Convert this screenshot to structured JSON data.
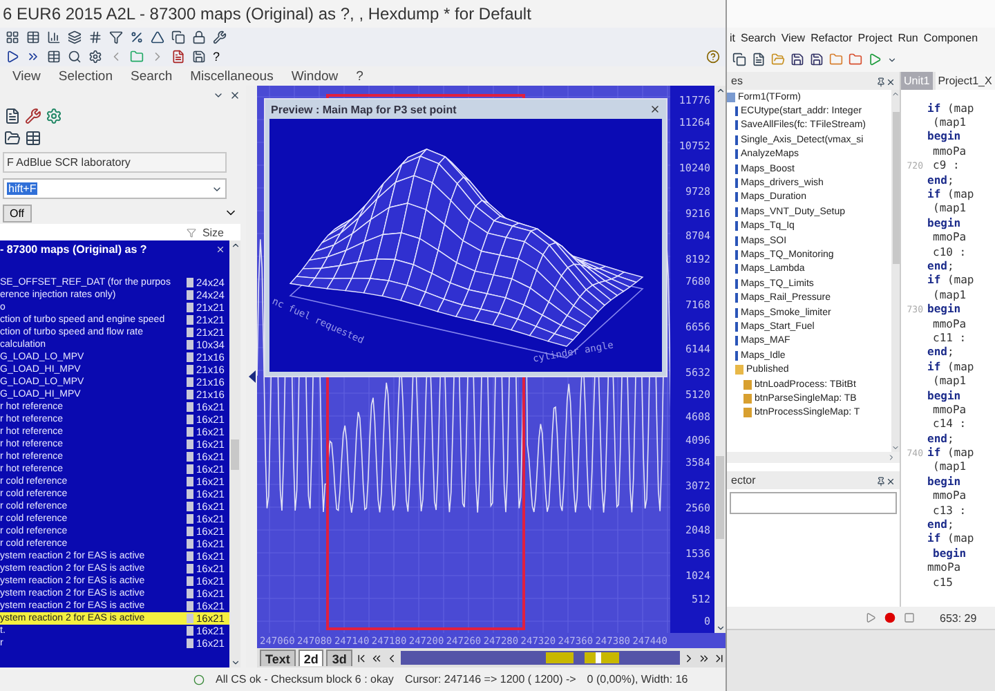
{
  "left_app": {
    "title": "6 EUR6 2015 A2L - 87300 maps (Original) as ?, , Hexdump * for Default",
    "toolbar_help": "?",
    "menu": [
      "View",
      "Selection",
      "Search",
      "Miscellaneous",
      "Window",
      "?"
    ],
    "panel": {
      "project_field": "F AdBlue SCR laboratory",
      "search_value": "hift+F",
      "filter_button": "Off",
      "size_header": "Size",
      "list_title": "- 87300 maps (Original) as ?",
      "maps": [
        {
          "name": "SE_OFFSET_REF_DAT (for the purpos",
          "size": "24x24",
          "selected": false
        },
        {
          "name": "erence injection rates only)",
          "size": "24x24",
          "selected": false
        },
        {
          "name": "o",
          "size": "21x21",
          "selected": false
        },
        {
          "name": "ction of turbo speed and engine speed",
          "size": "21x21",
          "selected": false
        },
        {
          "name": "ction of turbo speed and flow rate",
          "size": "21x21",
          "selected": false
        },
        {
          "name": "calculation",
          "size": "10x34",
          "selected": false
        },
        {
          "name": "G_LOAD_LO_MPV",
          "size": "21x16",
          "selected": false
        },
        {
          "name": "G_LOAD_HI_MPV",
          "size": "21x16",
          "selected": false
        },
        {
          "name": "G_LOAD_LO_MPV",
          "size": "21x16",
          "selected": false
        },
        {
          "name": "G_LOAD_HI_MPV",
          "size": "21x16",
          "selected": false
        },
        {
          "name": "r hot reference",
          "size": "16x21",
          "selected": false
        },
        {
          "name": "r hot reference",
          "size": "16x21",
          "selected": false
        },
        {
          "name": "r hot reference",
          "size": "16x21",
          "selected": false
        },
        {
          "name": "r hot reference",
          "size": "16x21",
          "selected": false
        },
        {
          "name": "r hot reference",
          "size": "16x21",
          "selected": false
        },
        {
          "name": "r hot reference",
          "size": "16x21",
          "selected": false
        },
        {
          "name": "r cold reference",
          "size": "16x21",
          "selected": false
        },
        {
          "name": "r cold reference",
          "size": "16x21",
          "selected": false
        },
        {
          "name": "r cold reference",
          "size": "16x21",
          "selected": false
        },
        {
          "name": "r cold reference",
          "size": "16x21",
          "selected": false
        },
        {
          "name": "r cold reference",
          "size": "16x21",
          "selected": false
        },
        {
          "name": "r cold reference",
          "size": "16x21",
          "selected": false
        },
        {
          "name": "ystem reaction 2 for EAS is active",
          "size": "16x21",
          "selected": false
        },
        {
          "name": "ystem reaction 2 for EAS is active",
          "size": "16x21",
          "selected": false
        },
        {
          "name": "ystem reaction 2 for EAS is active",
          "size": "16x21",
          "selected": false
        },
        {
          "name": "ystem reaction 2 for EAS is active",
          "size": "16x21",
          "selected": false
        },
        {
          "name": "ystem reaction 2 for EAS is active",
          "size": "16x21",
          "selected": false
        },
        {
          "name": "ystem reaction 2 for EAS is active",
          "size": "16x21",
          "selected": true
        },
        {
          "name": "t.",
          "size": "16x21",
          "selected": false
        },
        {
          "name": "r",
          "size": "16x21",
          "selected": false
        }
      ]
    },
    "graph": {
      "preview_title": "Preview : Main Map for P3 set point",
      "preview_axis_left": "nc fuel requested",
      "preview_axis_right": "cylinder angle",
      "y_labels": [
        "11776",
        "11264",
        "10752",
        "10240",
        "9728",
        "9216",
        "8704",
        "8192",
        "7680",
        "7168",
        "6656",
        "6144",
        "5632",
        "5120",
        "4608",
        "4096",
        "3584",
        "3072",
        "2560",
        "2048",
        "1536",
        "1024",
        "512",
        "0"
      ],
      "x_labels": [
        "247060",
        "247080",
        "247140",
        "247180",
        "247200",
        "247260",
        "247280",
        "247320",
        "247360",
        "247380",
        "247440"
      ],
      "view_tabs": [
        {
          "label": "Text",
          "selected": false
        },
        {
          "label": "2d",
          "selected": true
        },
        {
          "label": "3d",
          "selected": false
        }
      ]
    },
    "status": {
      "checksum": "All CS ok - Checksum block 6 : okay",
      "cursor": "Cursor: 247146 => 1200 ( 1200) ->",
      "width": "0 (0,00%), Width: 16"
    }
  },
  "right_app": {
    "menu": [
      "it",
      "Search",
      "View",
      "Refactor",
      "Project",
      "Run",
      "Componen"
    ],
    "structure": {
      "header": "es",
      "tree": [
        {
          "label": "Form1(TForm)",
          "kind": "class",
          "children": [
            {
              "label": "ECUtype(start_addr: Integer",
              "kind": "method"
            },
            {
              "label": "SaveAllFiles(fc: TFileStream)",
              "kind": "method"
            },
            {
              "label": "Single_Axis_Detect(vmax_si",
              "kind": "method"
            },
            {
              "label": "AnalyzeMaps",
              "kind": "method"
            },
            {
              "label": "Maps_Boost",
              "kind": "method"
            },
            {
              "label": "Maps_drivers_wish",
              "kind": "method"
            },
            {
              "label": "Maps_Duration",
              "kind": "method"
            },
            {
              "label": "Maps_VNT_Duty_Setup",
              "kind": "method"
            },
            {
              "label": "Maps_Tq_Iq",
              "kind": "method"
            },
            {
              "label": "Maps_SOI",
              "kind": "method"
            },
            {
              "label": "Maps_TQ_Monitoring",
              "kind": "method"
            },
            {
              "label": "Maps_Lambda",
              "kind": "method"
            },
            {
              "label": "Maps_TQ_Limits",
              "kind": "method"
            },
            {
              "label": "Maps_Rail_Pressure",
              "kind": "method"
            },
            {
              "label": "Maps_Smoke_limiter",
              "kind": "method"
            },
            {
              "label": "Maps_Start_Fuel",
              "kind": "method"
            },
            {
              "label": "Maps_MAF",
              "kind": "method"
            },
            {
              "label": "Maps_Idle",
              "kind": "method"
            },
            {
              "label": "Published",
              "kind": "folder",
              "children": [
                {
                  "label": "btnLoadProcess: TBitBt",
                  "kind": "field"
                },
                {
                  "label": "btnParseSingleMap: TB",
                  "kind": "field"
                },
                {
                  "label": "btnProcessSingleMap: T",
                  "kind": "field"
                }
              ]
            }
          ]
        }
      ]
    },
    "editor_tabs": [
      {
        "label": "Unit1",
        "selected": true
      },
      {
        "label": "Project1_X",
        "selected": false
      }
    ],
    "code": [
      {
        "text": "**if** (map"
      },
      {
        "text": "(map1"
      },
      {
        "text": "**begin**"
      },
      {
        "text": "mmoPa"
      },
      {
        "text": "c9 :",
        "number": "720"
      },
      {
        "text": "**end**;"
      },
      {
        "text": "**if** (map"
      },
      {
        "text": "(map1"
      },
      {
        "text": "**begin**"
      },
      {
        "text": "mmoPa"
      },
      {
        "text": "c10 :"
      },
      {
        "text": "**end**;"
      },
      {
        "text": "**if** (map"
      },
      {
        "text": "(map1"
      },
      {
        "text": "**begin**",
        "number": "730"
      },
      {
        "text": "mmoPa"
      },
      {
        "text": "c11 :"
      },
      {
        "text": "**end**;"
      },
      {
        "text": "**if** (map"
      },
      {
        "text": "(map1"
      },
      {
        "text": "**begin**"
      },
      {
        "text": "mmoPa"
      },
      {
        "text": "c14 :"
      },
      {
        "text": "**end**;"
      },
      {
        "text": "**if** (map",
        "number": "740"
      },
      {
        "text": "(map1"
      },
      {
        "text": "**begin**"
      },
      {
        "text": "mmoPa"
      },
      {
        "text": "c13 :"
      },
      {
        "text": "**end**;"
      },
      {
        "text": "**if** (map"
      },
      {
        "text": "**begin**"
      },
      {
        "text": "mmoPa"
      },
      {
        "text": "c15"
      }
    ],
    "inspector_title": "ector",
    "position": "653: 29"
  }
}
